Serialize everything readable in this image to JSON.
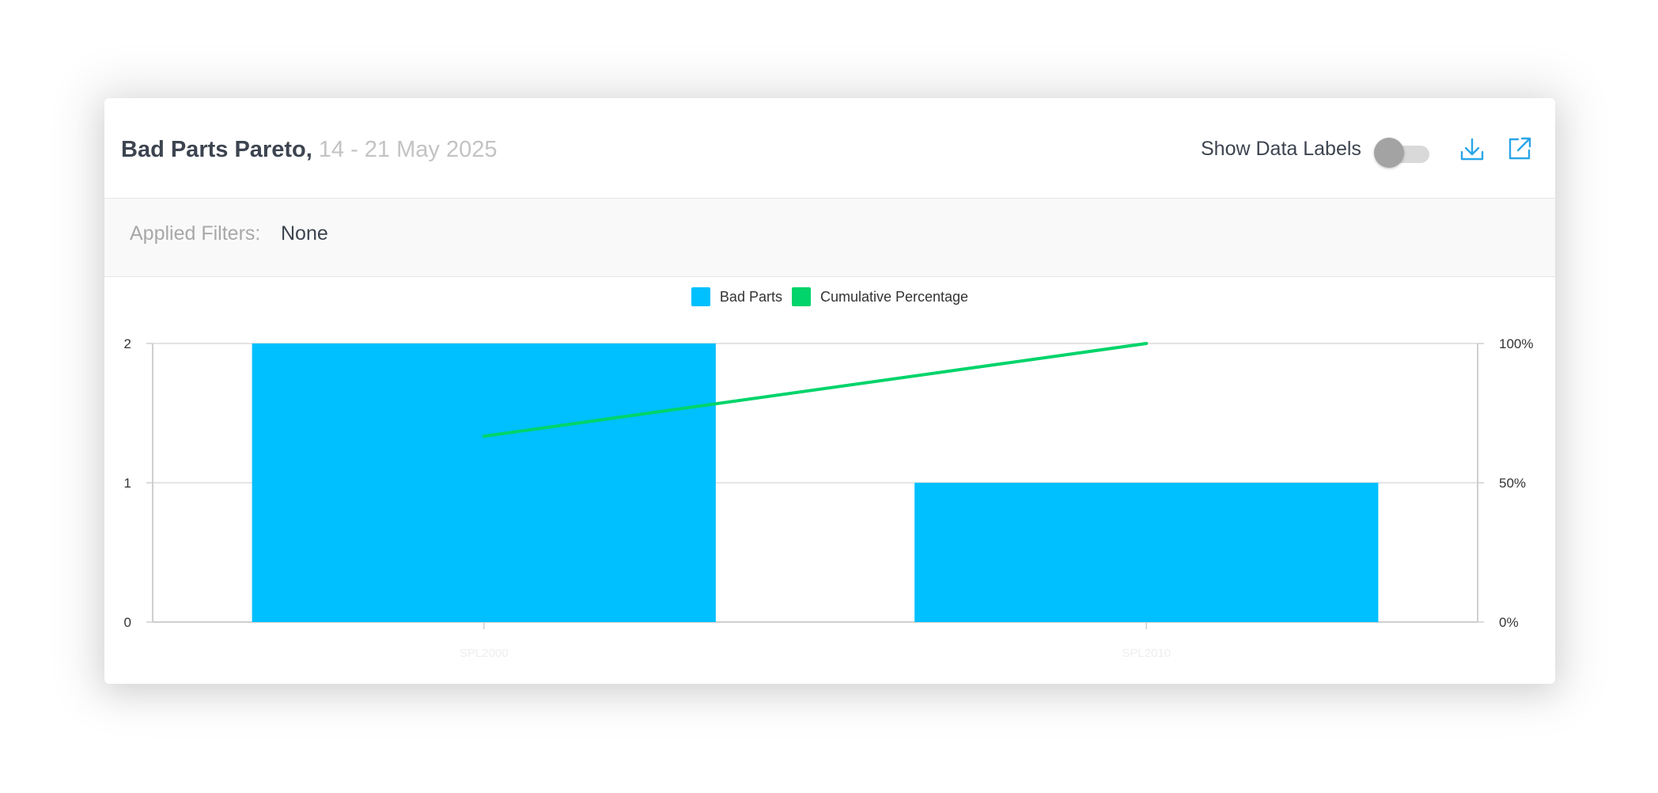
{
  "header": {
    "title": "Bad Parts Pareto,",
    "date_range": "14 - 21 May 2025",
    "toggle_label": "Show Data Labels",
    "toggle_on": false,
    "download_icon": "download-icon",
    "external_icon": "external-link-icon"
  },
  "filters": {
    "label": "Applied Filters:",
    "value": "None"
  },
  "colors": {
    "bar": "#00c0ff",
    "line": "#00d46a",
    "toggle_knob": "#a3a3a3"
  },
  "chart_data": {
    "type": "bar",
    "categories": [
      "SPL2000",
      "SPL2010"
    ],
    "series": [
      {
        "name": "Bad Parts",
        "type": "bar",
        "axis": "left",
        "values": [
          2,
          1
        ]
      },
      {
        "name": "Cumulative Percentage",
        "type": "line",
        "axis": "right",
        "values": [
          66.7,
          100
        ]
      }
    ],
    "ylim": [
      0,
      2
    ],
    "y_ticks": [
      "0",
      "1",
      "2"
    ],
    "y2lim": [
      0,
      100
    ],
    "y2_ticks": [
      "0%",
      "50%",
      "100%"
    ],
    "grid": true,
    "legend_position": "top"
  }
}
